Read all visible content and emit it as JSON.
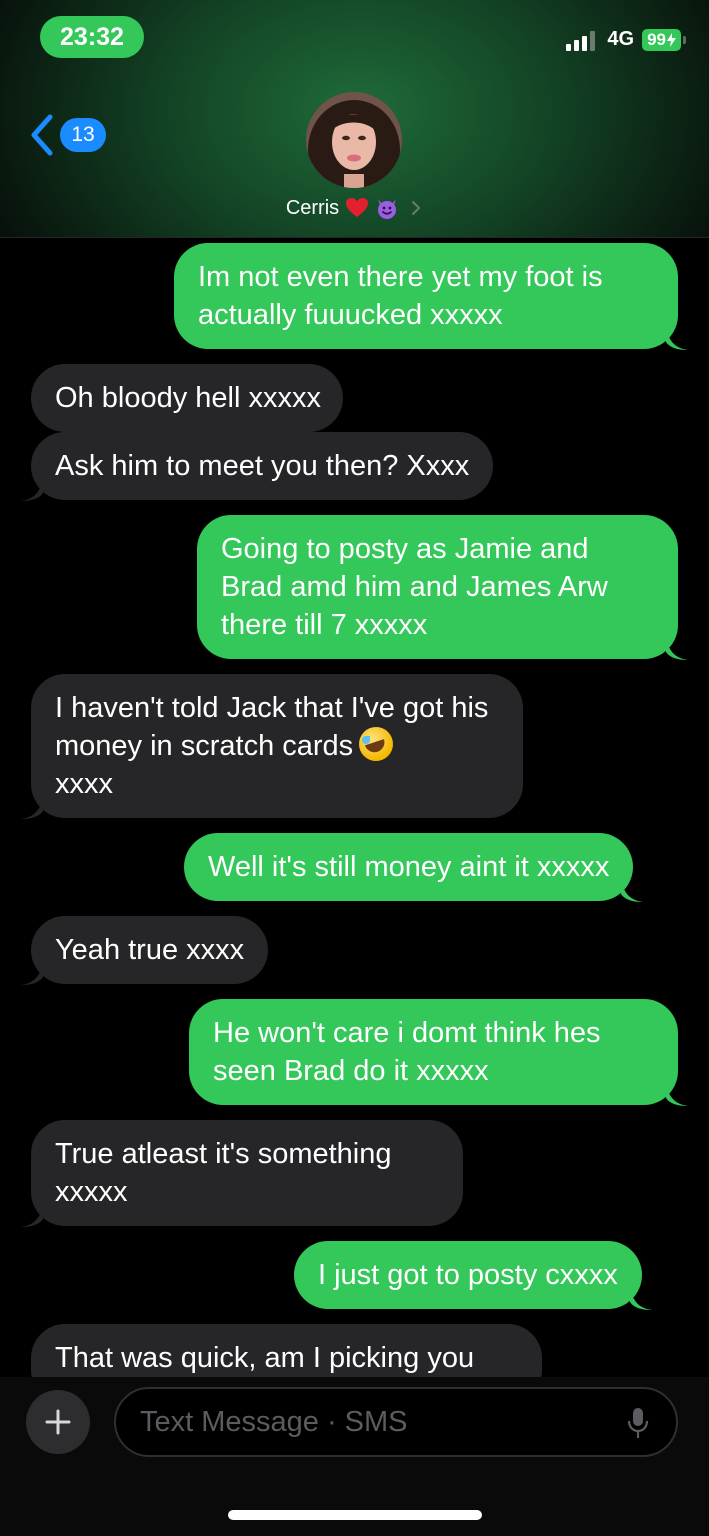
{
  "status_bar": {
    "time": "23:32",
    "network": "4G",
    "battery": "99"
  },
  "header": {
    "back_count": "13",
    "contact_name": "Cerris"
  },
  "messages": [
    {
      "side": "out",
      "text": "Im not even there yet my foot is actually fuuucked xxxxx"
    },
    {
      "side": "in",
      "text": "Oh bloody hell xxxxx"
    },
    {
      "side": "in",
      "text": "Ask him to meet you then? Xxxx"
    },
    {
      "side": "out",
      "text": "Going to posty as Jamie and Brad amd him and James Arw there till 7 xxxxx"
    },
    {
      "side": "in",
      "text": "I haven't told Jack that I've got his money in scratch cards",
      "text_after": "xxxx",
      "emoji": "rolling-on-floor-laughing-emoji"
    },
    {
      "side": "out",
      "text": "Well it's still money aint it xxxxx"
    },
    {
      "side": "in",
      "text": "Yeah true xxxx"
    },
    {
      "side": "out",
      "text": "He won't care i domt think hes seen Brad do it xxxxx"
    },
    {
      "side": "in",
      "text": "True atleast it's something xxxxx"
    },
    {
      "side": "out",
      "text": "I just got to posty cxxxx"
    },
    {
      "side": "in",
      "text": "That was quick, am I picking you"
    }
  ],
  "composer": {
    "placeholder": "Text Message · SMS"
  },
  "colors": {
    "outgoing": "#34c759",
    "incoming": "#262628",
    "accent": "#1a8cff"
  }
}
